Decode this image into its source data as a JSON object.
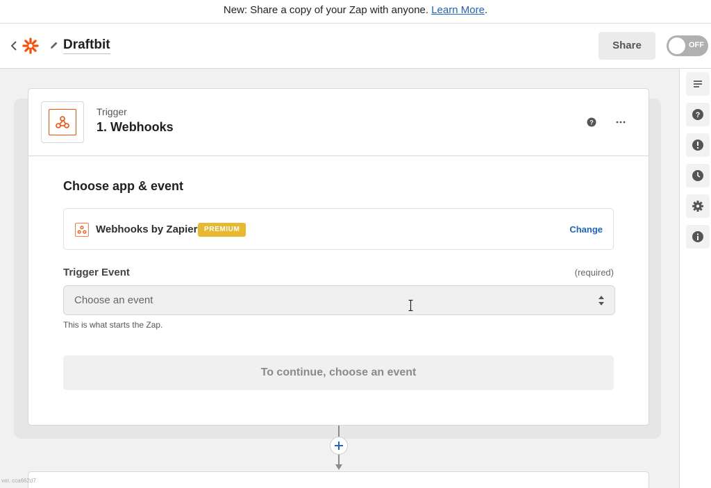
{
  "banner": {
    "text": "New: Share a copy of your Zap with anyone. ",
    "link": "Learn More",
    "suffix": "."
  },
  "header": {
    "zap_name": "Draftbit",
    "share_label": "Share",
    "toggle_label": "OFF"
  },
  "step": {
    "kind": "Trigger",
    "name": "1. Webhooks",
    "section_title": "Choose app & event",
    "app_name": "Webhooks by Zapier",
    "badge": "PREMIUM",
    "change_label": "Change",
    "field_label": "Trigger Event",
    "required_label": "(required)",
    "select_placeholder": "Choose an event",
    "hint": "This is what starts the Zap.",
    "continue_label": "To continue, choose an event"
  },
  "sidebar_icons": [
    "details-icon",
    "help-icon",
    "alert-icon",
    "history-icon",
    "settings-icon",
    "info-icon"
  ],
  "footer": {
    "version": "ver. cca662d7"
  },
  "colors": {
    "accent": "#ff4a00",
    "link": "#1d63c9",
    "premium": "#e8b831"
  }
}
